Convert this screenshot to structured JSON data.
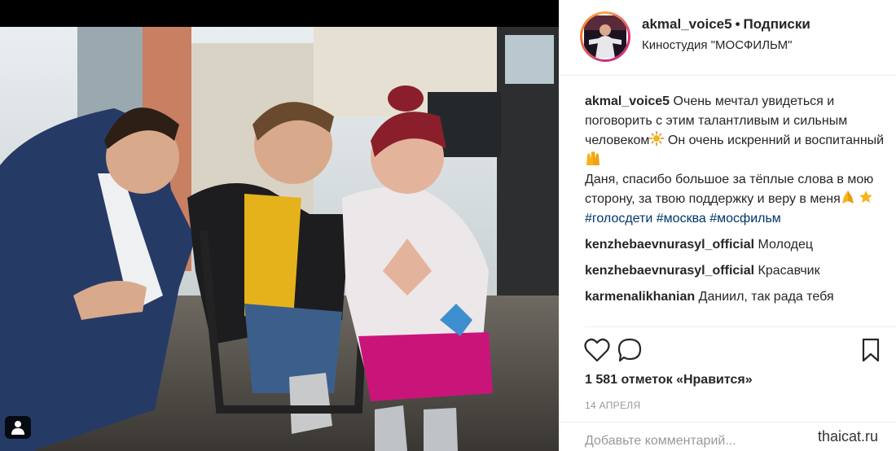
{
  "post": {
    "username": "akmal_voice5",
    "separator": "•",
    "follow_state": "Подписки",
    "location": "Киностудия \"МОСФИЛЬМ\""
  },
  "caption": {
    "author": "akmal_voice5",
    "line1": "Очень мечтал увидеться и поговорить с этим талантливым и сильным человеком",
    "line1_emoji": "sparkle-emoji",
    "line2": "Он очень искренний и воспитанный",
    "line2_emoji": "raised-hands-emoji",
    "line3": "Даня, спасибо большое за тёплые слова в мою сторону, за твою поддержку и веру в меня",
    "line3_emojis": [
      "folded-hands-emoji",
      "star-emoji"
    ],
    "hashtags": [
      "#голосдети",
      "#москва",
      "#мосфильм"
    ]
  },
  "comments": [
    {
      "author": "kenzhebaevnurasyl_official",
      "text": "Молодец"
    },
    {
      "author": "kenzhebaevnurasyl_official",
      "text": "Красавчик"
    },
    {
      "author": "karmenalikhanian",
      "text": "Даниил, так рада тебя"
    }
  ],
  "actions": {
    "like_icon": "heart-outline-icon",
    "comment_icon": "speech-bubble-icon",
    "save_icon": "bookmark-icon"
  },
  "likes_text": "1 581 отметок «Нравится»",
  "date_text": "14 апреля",
  "add_comment_placeholder": "Добавьте комментарий...",
  "tagged_icon": "person-tag-icon",
  "watermark": "thaicat.ru",
  "colors": {
    "hashtag": "#003569",
    "text": "#262626",
    "muted": "#999999",
    "divider": "#efefef"
  }
}
